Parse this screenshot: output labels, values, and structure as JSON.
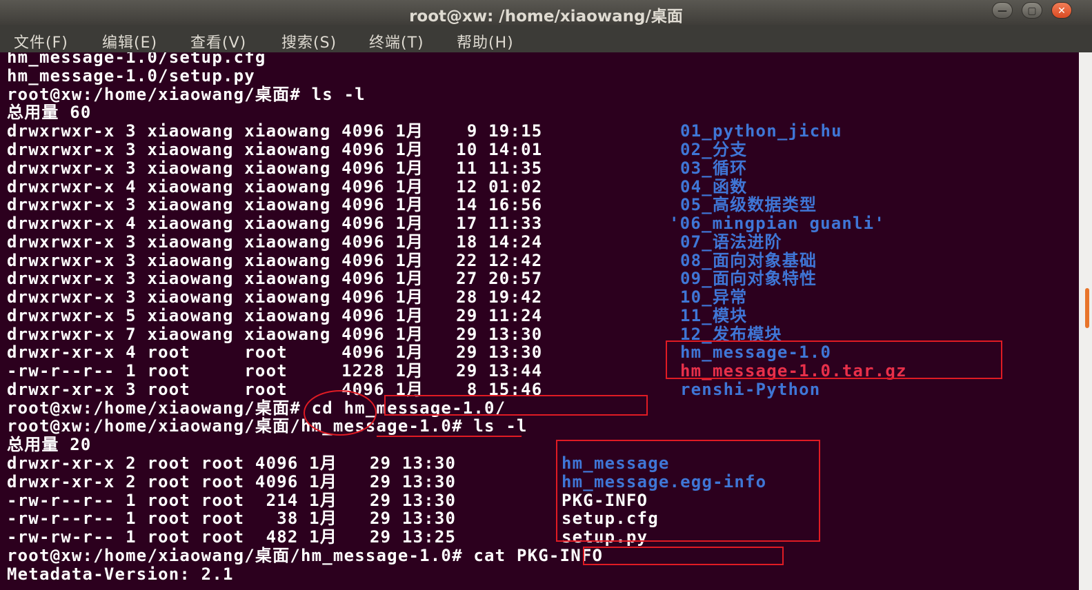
{
  "window": {
    "title": "root@xw: /home/xiaowang/桌面",
    "minimize_glyph": "—",
    "maximize_glyph": "▢",
    "close_glyph": "✕"
  },
  "menubar": [
    "文件(F)",
    "编辑(E)",
    "查看(V)",
    "搜索(S)",
    "终端(T)",
    "帮助(H)"
  ],
  "terminal": {
    "lines": [
      "hm_message-1.0/setup.cfg",
      "hm_message-1.0/setup.py",
      "root@xw:/home/xiaowang/桌面# ls -l",
      "总用量 60",
      "drwxrwxr-x 3 xiaowang xiaowang 4096 1月    9 19:15",
      "drwxrwxr-x 3 xiaowang xiaowang 4096 1月   10 14:01",
      "drwxrwxr-x 3 xiaowang xiaowang 4096 1月   11 11:35",
      "drwxrwxr-x 4 xiaowang xiaowang 4096 1月   12 01:02",
      "drwxrwxr-x 3 xiaowang xiaowang 4096 1月   14 16:56",
      "drwxrwxr-x 4 xiaowang xiaowang 4096 1月   17 11:33",
      "drwxrwxr-x 3 xiaowang xiaowang 4096 1月   18 14:24",
      "drwxrwxr-x 3 xiaowang xiaowang 4096 1月   22 12:42",
      "drwxrwxr-x 3 xiaowang xiaowang 4096 1月   27 20:57",
      "drwxrwxr-x 3 xiaowang xiaowang 4096 1月   28 19:42",
      "drwxrwxr-x 5 xiaowang xiaowang 4096 1月   29 11:24",
      "drwxrwxr-x 7 xiaowang xiaowang 4096 1月   29 13:30",
      "drwxr-xr-x 4 root     root     4096 1月   29 13:30",
      "-rw-r--r-- 1 root     root     1228 1月   29 13:44",
      "drwxr-xr-x 3 root     root     4096 1月    8 15:46",
      "root@xw:/home/xiaowang/桌面# cd hm_message-1.0/",
      "root@xw:/home/xiaowang/桌面/hm_message-1.0# ls -l",
      "总用量 20",
      "drwxr-xr-x 2 root root 4096 1月   29 13:30",
      "drwxr-xr-x 2 root root 4096 1月   29 13:30",
      "-rw-r--r-- 1 root root  214 1月   29 13:30",
      "-rw-r--r-- 1 root root   38 1月   29 13:30",
      "-rw-rw-r-- 1 root root  482 1月   29 13:25",
      "root@xw:/home/xiaowang/桌面/hm_message-1.0# cat PKG-INFO",
      "Metadata-Version: 2.1"
    ],
    "listing1_names": [
      {
        "name": "01_python_jichu",
        "color": "#3f76d6"
      },
      {
        "name": "02_分支",
        "color": "#3f76d6"
      },
      {
        "name": "03_循环",
        "color": "#3f76d6"
      },
      {
        "name": "04_函数",
        "color": "#3f76d6"
      },
      {
        "name": "05_高级数据类型",
        "color": "#3f76d6"
      },
      {
        "name": "'06_mingpian guanli'",
        "color": "#3f76d6"
      },
      {
        "name": "07_语法进阶",
        "color": "#3f76d6"
      },
      {
        "name": "08_面向对象基础",
        "color": "#3f76d6"
      },
      {
        "name": "09_面向对象特性",
        "color": "#3f76d6"
      },
      {
        "name": "10_异常",
        "color": "#3f76d6"
      },
      {
        "name": "11_模块",
        "color": "#3f76d6"
      },
      {
        "name": "12_发布模块",
        "color": "#3f76d6"
      },
      {
        "name": "hm_message-1.0",
        "color": "#3f76d6"
      },
      {
        "name": "hm_message-1.0.tar.gz",
        "color": "#e8304a"
      },
      {
        "name": "renshi-Python",
        "color": "#3f76d6"
      }
    ],
    "listing2_names": [
      {
        "name": "hm_message",
        "color": "#3f76d6"
      },
      {
        "name": "hm_message.egg-info",
        "color": "#3f76d6"
      },
      {
        "name": "PKG-INFO",
        "color": "#ffffff"
      },
      {
        "name": "setup.cfg",
        "color": "#ffffff"
      },
      {
        "name": "setup.py",
        "color": "#ffffff"
      }
    ]
  },
  "colors": {
    "background": "#2c001e",
    "directory": "#3f76d6",
    "archive": "#e8304a",
    "text": "#ffffff",
    "annotation": "#e01b24",
    "scroll_thumb": "#e8742a"
  }
}
